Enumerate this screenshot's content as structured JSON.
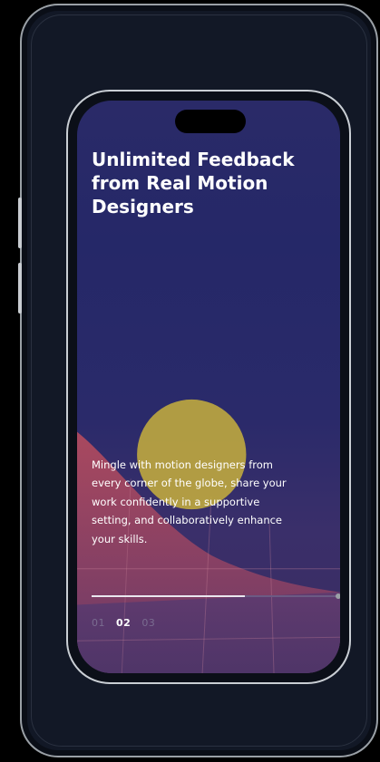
{
  "onboarding": {
    "headline": "Unlimited Feedback from Real Motion Designers",
    "body": "Mingle with motion designers from every corner of the globe, share your work confidently in a supportive setting, and collaboratively enhance your skills.",
    "progress": 0.62,
    "steps": [
      {
        "label": "01",
        "active": false
      },
      {
        "label": "02",
        "active": true
      },
      {
        "label": "03",
        "active": false
      }
    ]
  },
  "colors": {
    "background": "#000000",
    "screen_top": "#2a2a68",
    "accent_circle": "#c8b03c",
    "wave": "#b04a5e"
  },
  "icons": [
    "notch",
    "progress-dot"
  ]
}
